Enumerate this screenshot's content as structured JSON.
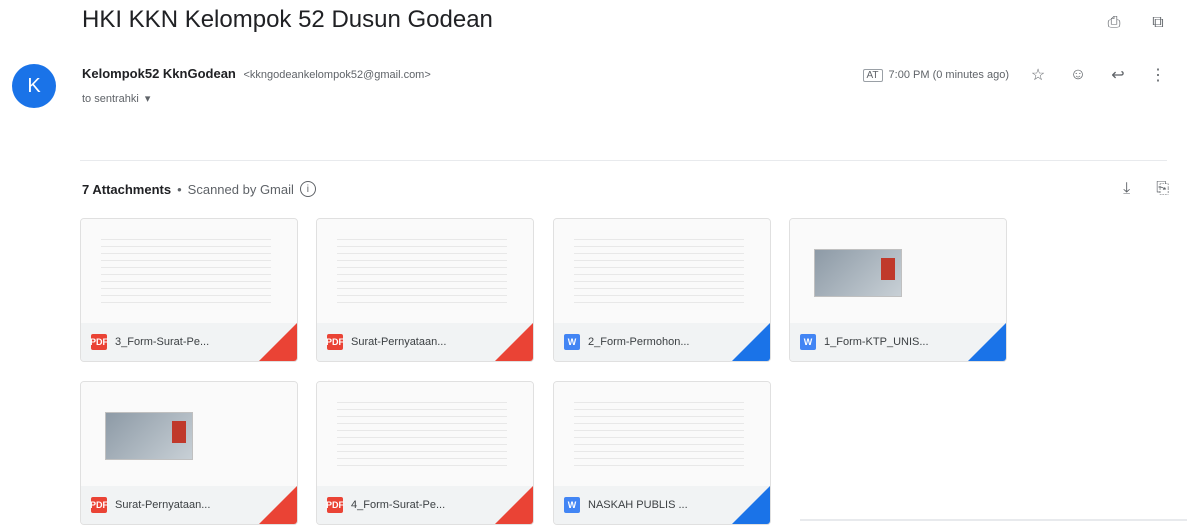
{
  "email": {
    "subject": "HKI KKN Kelompok 52 Dusun Godean",
    "sender_initial": "K",
    "sender_name": "Kelompok52 KknGodean",
    "sender_email": "<kkngodeankelompok52@gmail.com>",
    "to": "to sentrahki",
    "time": "7:00 PM (0 minutes ago)",
    "time_tag": "AT"
  },
  "attachments_header": {
    "count_label": "7 Attachments",
    "separator": "•",
    "scanned_label": "Scanned by Gmail"
  },
  "icons": {
    "print": "⎙",
    "open_new": "⧉",
    "star": "☆",
    "emoji": "☺",
    "reply": "↩",
    "more": "⋮",
    "download": "⤓",
    "save_drive": "⎘",
    "dropdown": "▾",
    "info": "i"
  },
  "attachments": [
    {
      "name": "3_Form-Surat-Pe...",
      "type": "pdf",
      "type_label": "PDF",
      "thumb": "lines"
    },
    {
      "name": "Surat-Pernyataan...",
      "type": "pdf",
      "type_label": "PDF",
      "thumb": "lines"
    },
    {
      "name": "2_Form-Permohon...",
      "type": "doc",
      "type_label": "W",
      "thumb": "lines"
    },
    {
      "name": "1_Form-KTP_UNIS...",
      "type": "doc",
      "type_label": "W",
      "thumb": "photo"
    },
    {
      "name": "Surat-Pernyataan...",
      "type": "pdf",
      "type_label": "PDF",
      "thumb": "photo"
    },
    {
      "name": "4_Form-Surat-Pe...",
      "type": "pdf",
      "type_label": "PDF",
      "thumb": "lines"
    },
    {
      "name": "NASKAH PUBLIS ...",
      "type": "doc",
      "type_label": "W",
      "thumb": "lines"
    }
  ],
  "colors": {
    "avatar": "#1a73e8",
    "pdf": "#ea4335",
    "doc": "#4285f4"
  }
}
